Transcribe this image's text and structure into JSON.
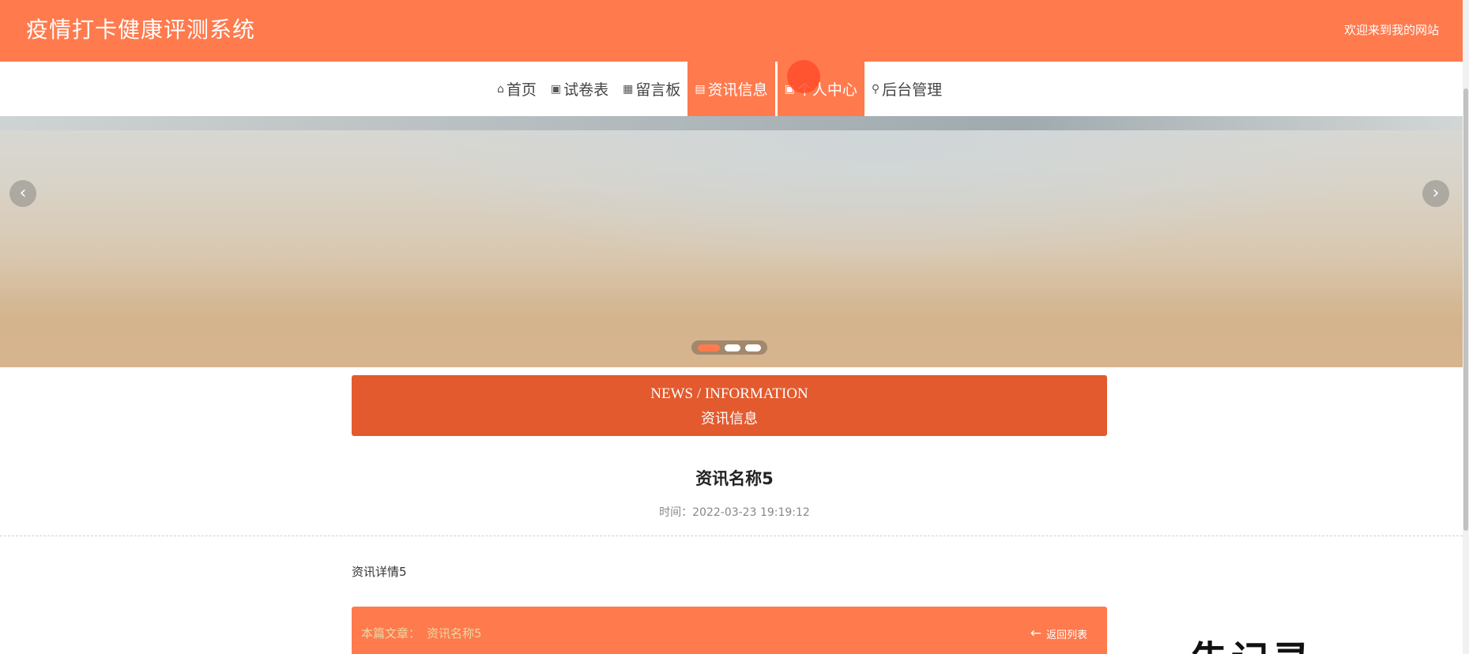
{
  "header": {
    "site_title": "疫情打卡健康评测系统",
    "welcome_text": "欢迎来到我的网站"
  },
  "nav": {
    "items": [
      {
        "label": "首页",
        "icon": "home-icon",
        "glyph": "⌂"
      },
      {
        "label": "试卷表",
        "icon": "grid-icon",
        "glyph": "▣"
      },
      {
        "label": "留言板",
        "icon": "apps-icon",
        "glyph": "▦"
      },
      {
        "label": "资讯信息",
        "icon": "news-icon",
        "glyph": "▤"
      },
      {
        "label": "个人中心",
        "icon": "user-icon",
        "glyph": "▣"
      },
      {
        "label": "后台管理",
        "icon": "link-icon",
        "glyph": "⚲"
      }
    ]
  },
  "carousel": {
    "prev_glyph": "‹",
    "next_glyph": "›",
    "slide_count": 3,
    "active_slide": 1
  },
  "section": {
    "title_en": "NEWS / INFORMATION",
    "title_zh": "资讯信息"
  },
  "article": {
    "title": "资讯名称5",
    "time": "时间：2022-03-23 19:19:12",
    "body": "资讯详情5"
  },
  "footer_bar": {
    "this_label": "本篇文章：",
    "this_name": "资讯名称5",
    "back_label": "返回列表",
    "back_glyph": "←"
  },
  "overlay": {
    "text": "告记录"
  },
  "colors": {
    "primary": "#ff7a4d",
    "section_head": "#e35a2e"
  }
}
